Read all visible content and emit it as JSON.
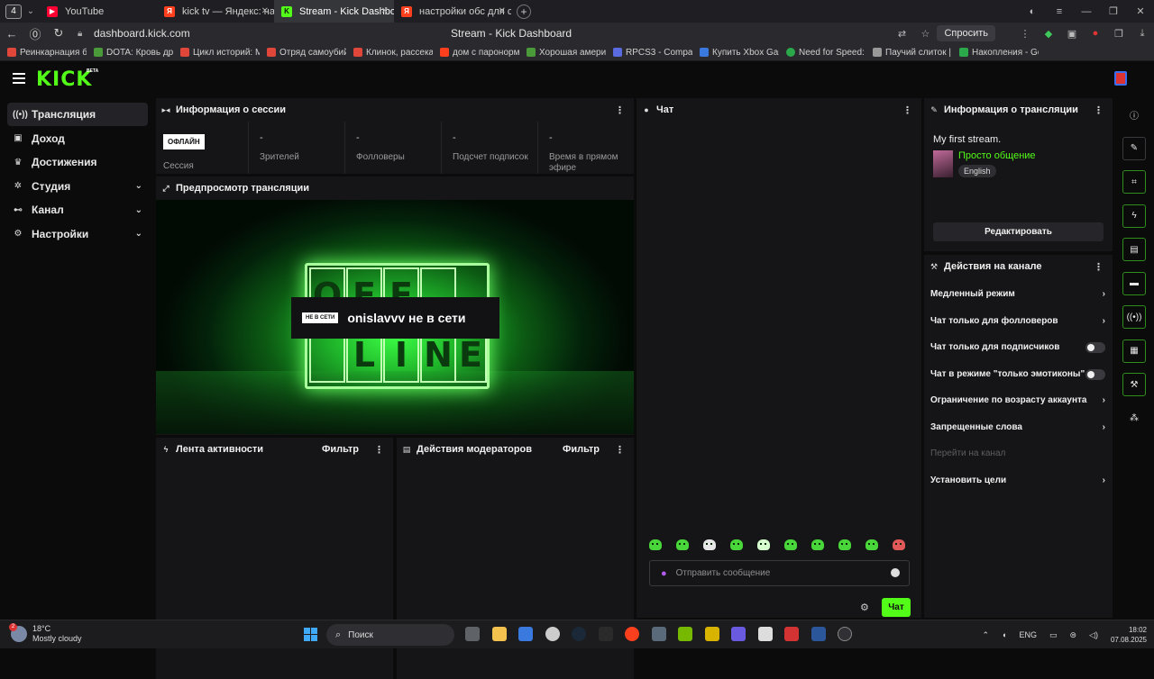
{
  "browser": {
    "tab_counter": "4",
    "tabs": [
      {
        "title": "YouTube",
        "icon": "youtube-icon",
        "color": "#ff0033"
      },
      {
        "title": "kick tv — Яндекс: нашлось",
        "icon": "yandex-icon",
        "color": "#fc3f1d"
      },
      {
        "title": "Stream - Kick Dashboard",
        "icon": "kick-icon",
        "color": "#53fc18"
      },
      {
        "title": "настройки обс для стрима",
        "icon": "yandex-icon",
        "color": "#fc3f1d"
      }
    ],
    "url": "dashboard.kick.com",
    "page_title": "Stream - Kick Dashboard",
    "ask_label": "Спросить",
    "bookmarks": [
      {
        "label": "Реинкарнация без",
        "color": "#e0463a"
      },
      {
        "label": "DOTA: Кровь драк",
        "color": "#4a9a3a"
      },
      {
        "label": "Цикл историй: М",
        "color": "#e0463a"
      },
      {
        "label": "Отряд самоубийц",
        "color": "#e0463a"
      },
      {
        "label": "Клинок, рассекаю",
        "color": "#e0463a"
      },
      {
        "label": "дом с паронормал",
        "color": "#fc3f1d"
      },
      {
        "label": "Хорошая америк",
        "color": "#4a9a3a"
      },
      {
        "label": "RPCS3 - Compatib",
        "color": "#5a6adf"
      },
      {
        "label": "Купить Xbox Gam",
        "color": "#3a7adf"
      },
      {
        "label": "Need for Speed: M",
        "color": "#2aa84a"
      },
      {
        "label": "Паучий слиток | П",
        "color": "#999999"
      },
      {
        "label": "Накопления - Goo",
        "color": "#2aa84a"
      }
    ]
  },
  "app": {
    "logo": "KICK",
    "logo_beta": "BETA",
    "accent": "#53fc18",
    "sidebar": [
      {
        "label": "Трансляция",
        "icon": "broadcast-icon",
        "active": true,
        "expandable": false
      },
      {
        "label": "Доход",
        "icon": "wallet-icon",
        "active": false,
        "expandable": false
      },
      {
        "label": "Достижения",
        "icon": "trophy-icon",
        "active": false,
        "expandable": false
      },
      {
        "label": "Студия",
        "icon": "studio-icon",
        "active": false,
        "expandable": true
      },
      {
        "label": "Канал",
        "icon": "channel-icon",
        "active": false,
        "expandable": true
      },
      {
        "label": "Настройки",
        "icon": "gear-icon",
        "active": false,
        "expandable": true
      }
    ],
    "session": {
      "title": "Информация о сессии",
      "status_badge": "ОФЛАЙН",
      "status_label": "Сессия",
      "stats": [
        {
          "value": "-",
          "label": "Зрителей"
        },
        {
          "value": "-",
          "label": "Фолловеры"
        },
        {
          "value": "-",
          "label": "Подсчет подписок"
        },
        {
          "value": "-",
          "label": "Время в прямом эфире"
        }
      ]
    },
    "preview": {
      "title": "Предпросмотр трансляции",
      "offline_badge": "НЕ В СЕТИ",
      "offline_text": "onislavvv не в сети",
      "sign_top": [
        "O",
        "F",
        "F",
        ""
      ],
      "sign_bottom": [
        "",
        "L",
        "I",
        "N",
        "E"
      ]
    },
    "activity": {
      "title": "Лента активности",
      "filter": "Фильтр"
    },
    "mod_actions": {
      "title": "Действия модераторов",
      "filter": "Фильтр"
    },
    "chat": {
      "title": "Чат",
      "placeholder": "Отправить сообщение",
      "send_label": "Чат",
      "emote_count": 10
    },
    "stream_info": {
      "title": "Информация о трансляции",
      "stream_title": "My first stream.",
      "category": "Просто общение",
      "language": "English",
      "edit_label": "Редактировать"
    },
    "channel_actions": {
      "title": "Действия на канале",
      "items": [
        {
          "label": "Медленный режим",
          "control": "chevron",
          "disabled": false
        },
        {
          "label": "Чат только для фолловеров",
          "control": "chevron",
          "disabled": false
        },
        {
          "label": "Чат только для подписчиков",
          "control": "toggle",
          "disabled": false
        },
        {
          "label": "Чат в режиме \"только эмотиконы\"",
          "control": "toggle",
          "disabled": false
        },
        {
          "label": "Ограничение по возрасту аккаунта",
          "control": "chevron",
          "disabled": false
        },
        {
          "label": "Запрещенные слова",
          "control": "chevron",
          "disabled": false
        },
        {
          "label": "Перейти на канал",
          "control": "none",
          "disabled": true
        },
        {
          "label": "Установить цели",
          "control": "chevron",
          "disabled": false
        }
      ]
    },
    "rail": [
      {
        "icon": "info-icon",
        "style": ""
      },
      {
        "icon": "pencil-icon",
        "style": "boxed"
      },
      {
        "icon": "focus-icon",
        "style": "boxed-g"
      },
      {
        "icon": "lightning-icon",
        "style": "boxed-g"
      },
      {
        "icon": "document-icon",
        "style": "boxed-g"
      },
      {
        "icon": "chat-bubble-icon",
        "style": "boxed-g"
      },
      {
        "icon": "broadcast-icon",
        "style": "boxed-g"
      },
      {
        "icon": "layout-icon",
        "style": "boxed-g"
      },
      {
        "icon": "wrench-icon",
        "style": "boxed-g"
      },
      {
        "icon": "nodes-icon",
        "style": ""
      }
    ]
  },
  "taskbar": {
    "weather_temp": "18°C",
    "weather_desc": "Mostly cloudy",
    "weather_badge": "2",
    "search_label": "Поиск",
    "apps": [
      {
        "icon": "file-explorer-icon",
        "color": "#5f6368"
      },
      {
        "icon": "folder-icon",
        "color": "#f2c14e"
      },
      {
        "icon": "store-icon",
        "color": "#3a7adf"
      },
      {
        "icon": "clock-app-icon",
        "color": "#cccccc"
      },
      {
        "icon": "steam-icon",
        "color": "#1b2838"
      },
      {
        "icon": "epic-icon",
        "color": "#2a2a2a"
      },
      {
        "icon": "yandex-browser-icon",
        "color": "#fc3f1d"
      },
      {
        "icon": "shield-app-icon",
        "color": "#5a6a7a"
      },
      {
        "icon": "nvidia-icon",
        "color": "#76b900"
      },
      {
        "icon": "sun-app-icon",
        "color": "#d8b400"
      },
      {
        "icon": "gamepad-icon",
        "color": "#6a5adf"
      },
      {
        "icon": "notepad-icon",
        "color": "#dddddd"
      },
      {
        "icon": "kick-app-icon",
        "color": "#d33333"
      },
      {
        "icon": "word-icon",
        "color": "#2b579a"
      },
      {
        "icon": "obs-icon",
        "color": "#303035"
      }
    ],
    "lang": "ENG",
    "time": "18:02",
    "date": "07.08.2025"
  }
}
